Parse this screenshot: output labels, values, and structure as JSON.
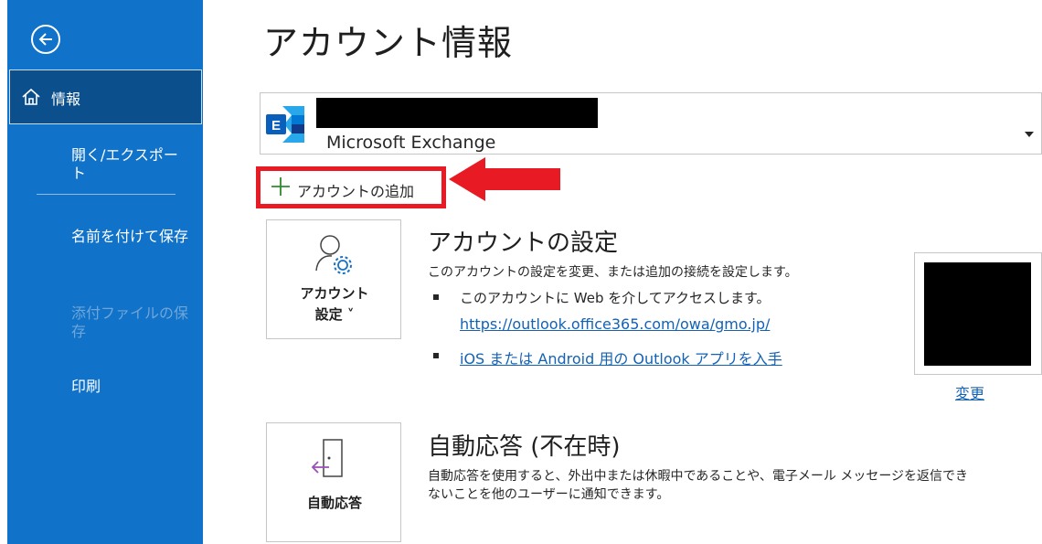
{
  "page_title": "アカウント情報",
  "sidebar": {
    "items": [
      {
        "label": "情報"
      },
      {
        "label": "開く/エクスポート"
      },
      {
        "label": "名前を付けて保存"
      },
      {
        "label": "添付ファイルの保存"
      },
      {
        "label": "印刷"
      }
    ]
  },
  "account": {
    "type": "Microsoft Exchange",
    "add_label": "アカウントの追加"
  },
  "account_settings": {
    "tile_label_line1": "アカウント",
    "tile_label_line2": "設定 ˅",
    "title": "アカウントの設定",
    "description": "このアカウントの設定を変更、または追加の接続を設定します。",
    "bullet1": "このアカウントに Web を介してアクセスします。",
    "owa_link": "https://outlook.office365.com/owa/gmo.jp/",
    "mobile_link": "iOS または Android 用の Outlook アプリを入手",
    "change_label": "変更"
  },
  "auto_reply": {
    "tile_label": "自動応答",
    "title": "自動応答 (不在時)",
    "description_line1": "自動応答を使用すると、外出中または休暇中であることや、電子メール メッセージを返信でき",
    "description_line2": "ないことを他のユーザーに通知できます。"
  },
  "colors": {
    "sidebar": "#1072c8",
    "sidebar_selected": "#0b4f8c",
    "link": "#1462b4",
    "highlight": "#e81b24"
  }
}
